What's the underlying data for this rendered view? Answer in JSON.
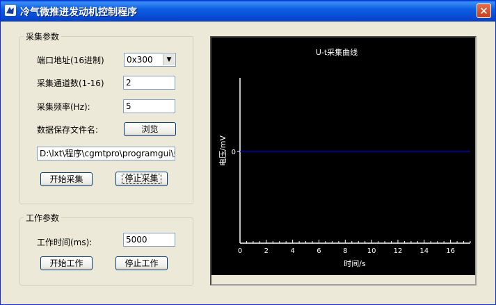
{
  "window": {
    "title": "冷气微推进发动机控制程序",
    "close_glyph": "✕"
  },
  "acquisition": {
    "group_title": "采集参数",
    "port_label": "端口地址(16进制)",
    "port_value": "0x300",
    "channels_label": "采集通道数(1-16)",
    "channels_value": "2",
    "freq_label": "采集频率(Hz):",
    "freq_value": "5",
    "file_label": "数据保存文件名:",
    "browse_button": "浏览",
    "file_path": "D:\\lxt\\程序\\cgmtpro\\programgui\\数",
    "start_button": "开始采集",
    "stop_button": "停止采集"
  },
  "work": {
    "group_title": "工作参数",
    "time_label": "工作时间(ms):",
    "time_value": "5000",
    "start_button": "开始工作",
    "stop_button": "停止工作"
  },
  "chart_data": {
    "type": "line",
    "title": "U-t采集曲线",
    "xlabel": "时间/s",
    "ylabel": "电压/mV",
    "xlim": [
      0,
      17.5
    ],
    "x_ticks": [
      0,
      2,
      4,
      6,
      8,
      10,
      12,
      14,
      16
    ],
    "y_ticks": [
      0
    ],
    "series": [
      {
        "x": [
          0,
          17.5
        ],
        "y": [
          0,
          0
        ],
        "color": "#0000ff"
      }
    ],
    "background": "#000000",
    "axis_color": "#ffffff"
  }
}
